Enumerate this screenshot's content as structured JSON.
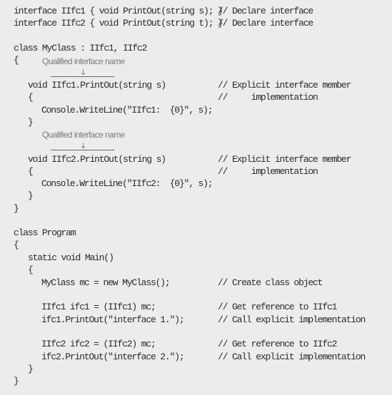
{
  "code_lines": [
    {
      "code": "interface IIfc1 { void PrintOut(string s); }",
      "comment": "// Declare interface"
    },
    {
      "code": "interface IIfc2 { void PrintOut(string t); }",
      "comment": "// Declare interface"
    },
    {
      "code": "class MyClass : IIfc1, IIfc2"
    },
    {
      "code": "{"
    },
    {
      "code": "void IIfc1.PrintOut(string s)",
      "comment": "// Explicit interface member"
    },
    {
      "code": "{",
      "comment": "//     implementation"
    },
    {
      "code": "Console.WriteLine(\"IIfc1:  {0}\", s);"
    },
    {
      "code": "}"
    },
    {
      "code": "void IIfc2.PrintOut(string s)",
      "comment": "// Explicit interface member"
    },
    {
      "code": "{",
      "comment": "//     implementation"
    },
    {
      "code": "Console.WriteLine(\"IIfc2:  {0}\", s);"
    },
    {
      "code": "}"
    },
    {
      "code": "}"
    },
    {
      "code": "class Program"
    },
    {
      "code": "{"
    },
    {
      "code": "static void Main()"
    },
    {
      "code": "{"
    },
    {
      "code": "MyClass mc = new MyClass();",
      "comment": "// Create class object"
    },
    {
      "code": "IIfc1 ifc1 = (IIfc1) mc;",
      "comment": "// Get reference to IIfc1"
    },
    {
      "code": "ifc1.PrintOut(\"interface 1.\");",
      "comment": "// Call explicit implementation"
    },
    {
      "code": "IIfc2 ifc2 = (IIfc2) mc;",
      "comment": "// Get reference to IIfc2"
    },
    {
      "code": "ifc2.PrintOut(\"interface 2.\");",
      "comment": "// Call explicit implementation"
    },
    {
      "code": "}"
    },
    {
      "code": "}"
    }
  ],
  "annotations": [
    {
      "label": "Qualified interface name",
      "arrow": "↓"
    },
    {
      "label": "Qualified interface name",
      "arrow": "↓"
    }
  ],
  "colors": {
    "background": "#ececec",
    "code_text": "#2a2a2a",
    "annotation_text": "#7a7a7a"
  }
}
